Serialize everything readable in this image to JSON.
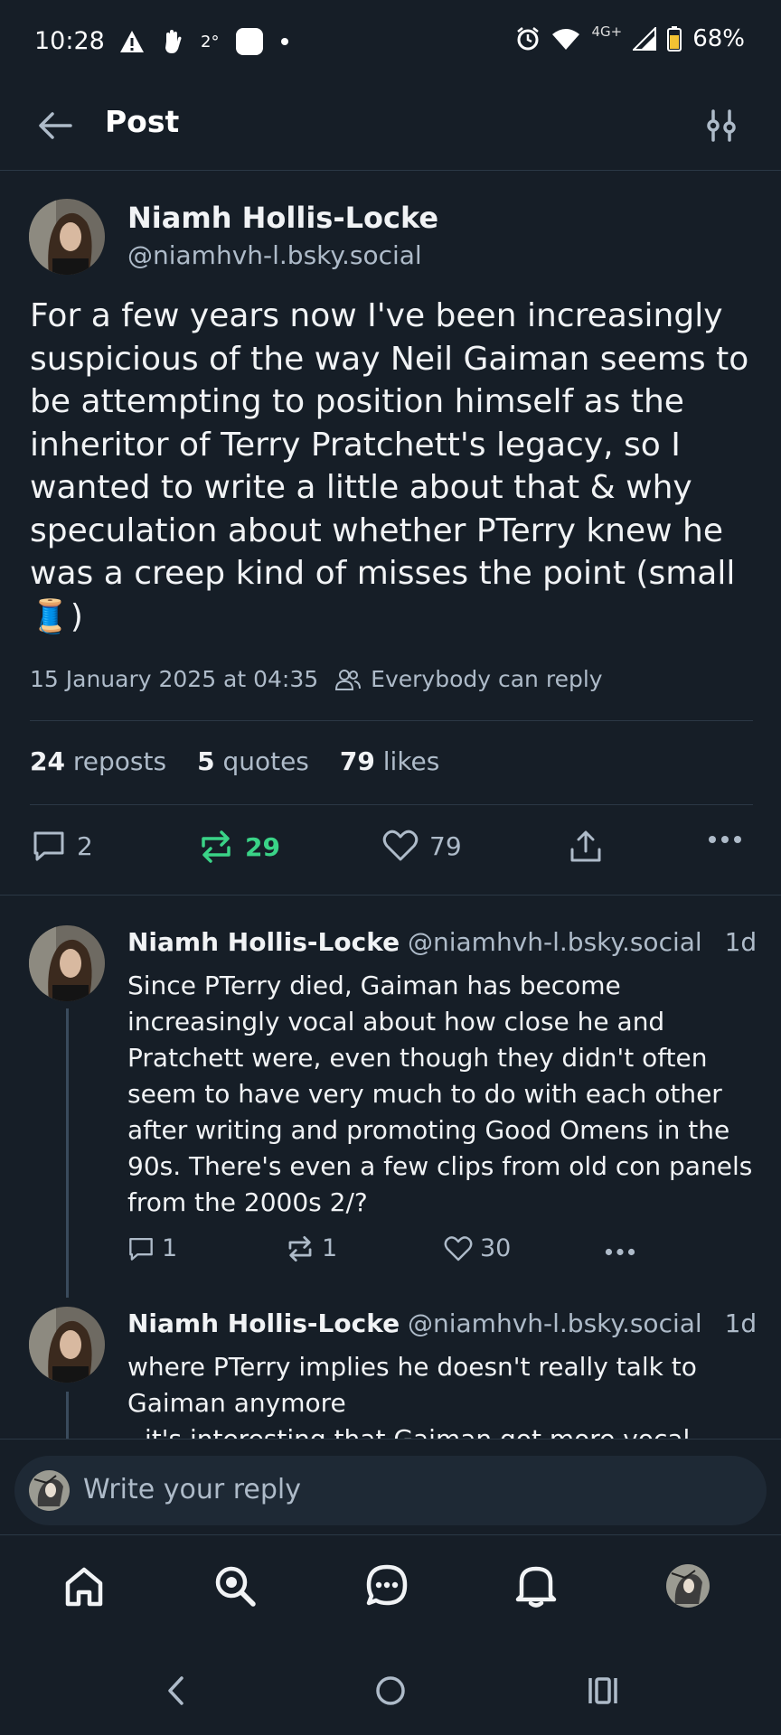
{
  "status_bar": {
    "time": "10:28",
    "temp": "2°",
    "network": "4G+",
    "battery": "68%"
  },
  "header": {
    "title": "Post"
  },
  "post": {
    "author_name": "Niamh Hollis-Locke",
    "author_handle": "@niamhvh-l.bsky.social",
    "text": "For a few years now I've been increasingly suspicious of the way Neil Gaiman seems to be attempting to position himself as the inheritor of Terry Pratchett's legacy, so I wanted to write a little about that & why speculation about whether PTerry knew he was a creep kind of misses the point (small 🧵)",
    "timestamp": "15 January 2025 at 04:35",
    "reply_setting": "Everybody can reply",
    "reposts_count": "24",
    "reposts_label": "reposts",
    "quotes_count": "5",
    "quotes_label": "quotes",
    "likes_count": "79",
    "likes_label": "likes",
    "actions": {
      "replies": "2",
      "reposts": "29",
      "likes": "79"
    },
    "repost_color": "#3ad387"
  },
  "replies": [
    {
      "author_name": "Niamh Hollis-Locke",
      "author_handle": "@niamhvh-l.bsky.social",
      "age": "1d",
      "text": "Since PTerry died, Gaiman has become increasingly vocal about how close he and Pratchett were, even though they didn't often seem to have very much to do with each other after writing and promoting Good Omens in the 90s. There's even a few clips from old con panels from the 2000s 2/?",
      "replies": "1",
      "reposts": "1",
      "likes": "30"
    },
    {
      "author_name": "Niamh Hollis-Locke",
      "author_handle": "@niamhvh-l.bsky.social",
      "age": "1d",
      "text": "where PTerry implies he doesn't really talk to Gaiman anymore",
      "text_cut": "- it's interesting that Gaiman got more vocal"
    }
  ],
  "composer": {
    "placeholder": "Write your reply"
  },
  "bottom_nav": [
    "home-icon",
    "search-icon",
    "chat-icon",
    "notifications-icon",
    "profile-avatar"
  ]
}
